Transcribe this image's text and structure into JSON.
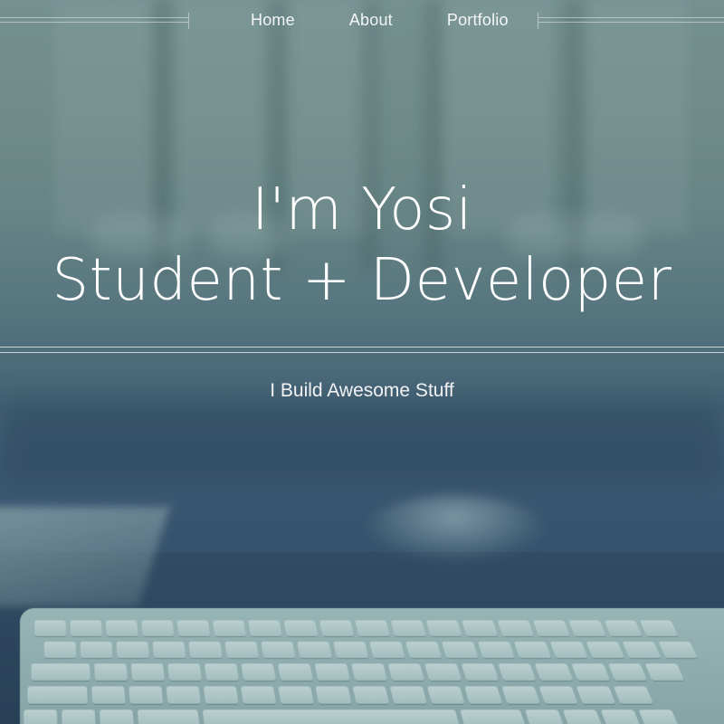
{
  "nav": {
    "items": [
      {
        "label": "Home"
      },
      {
        "label": "About"
      },
      {
        "label": "Portfolio"
      }
    ]
  },
  "hero": {
    "title_line1": "I'm Yosi",
    "title_line2": "Student + Developer",
    "subtitle": "I Build Awesome Stuff"
  },
  "colors": {
    "text": "#ffffff",
    "background_top": "#7f9b98",
    "background_bottom": "#33506b"
  },
  "background": {
    "scene": "desk-with-keyboard-image"
  }
}
